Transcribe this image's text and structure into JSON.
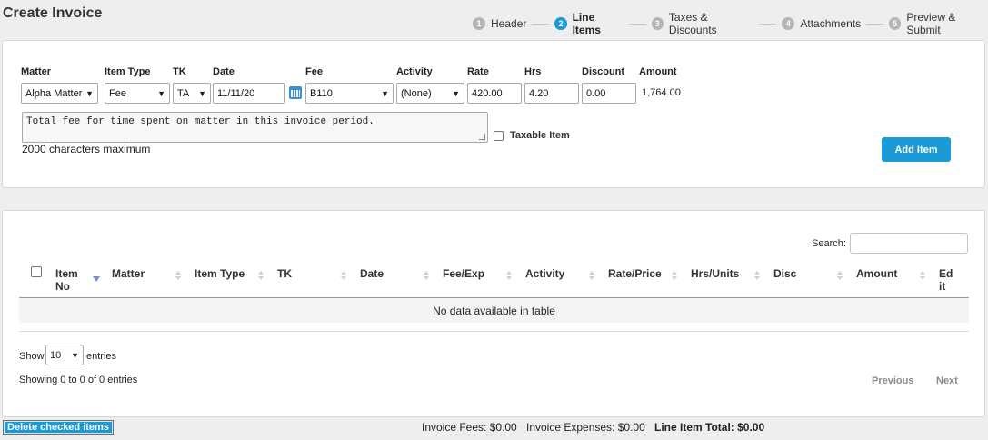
{
  "page": {
    "title": "Create Invoice"
  },
  "wizard": {
    "steps": [
      {
        "number": "1",
        "label": "Header",
        "active": false
      },
      {
        "number": "2",
        "label": "Line Items",
        "active": true
      },
      {
        "number": "3",
        "label": "Taxes & Discounts",
        "active": false
      },
      {
        "number": "4",
        "label": "Attachments",
        "active": false
      },
      {
        "number": "5",
        "label": "Preview & Submit",
        "active": false
      }
    ]
  },
  "form": {
    "labels": {
      "matter": "Matter",
      "item_type": "Item Type",
      "tk": "TK",
      "date": "Date",
      "fee": "Fee",
      "activity": "Activity",
      "rate": "Rate",
      "hrs": "Hrs",
      "discount": "Discount",
      "amount": "Amount"
    },
    "values": {
      "matter": "Alpha Matter",
      "item_type": "Fee",
      "tk": "TA",
      "date": "11/11/20",
      "fee": "B110",
      "activity": "(None)",
      "rate": "420.00",
      "hrs": "4.20",
      "discount": "0.00",
      "amount": "1,764.00"
    },
    "description": "Total fee for time spent on matter in this invoice period.",
    "char_limit_note": "2000 characters maximum",
    "taxable_label": "Taxable Item",
    "taxable_checked": false,
    "add_button": "Add Item"
  },
  "table": {
    "search_label": "Search:",
    "search_value": "",
    "columns": [
      {
        "line1": "Item",
        "line2": "No"
      },
      {
        "line1": "Matter",
        "line2": ""
      },
      {
        "line1": "Item Type",
        "line2": ""
      },
      {
        "line1": "TK",
        "line2": ""
      },
      {
        "line1": "Date",
        "line2": ""
      },
      {
        "line1": "Fee/Exp",
        "line2": ""
      },
      {
        "line1": "Activity",
        "line2": ""
      },
      {
        "line1": "Rate/Price",
        "line2": ""
      },
      {
        "line1": "Hrs/Units",
        "line2": ""
      },
      {
        "line1": "Disc",
        "line2": ""
      },
      {
        "line1": "Amount",
        "line2": ""
      },
      {
        "line1": "Ed",
        "line2": "it"
      }
    ],
    "empty_message": "No data available in table",
    "length": {
      "show": "Show",
      "value": "10",
      "entries": "entries"
    },
    "info": "Showing 0 to 0 of 0 entries",
    "pagination": {
      "previous": "Previous",
      "next": "Next"
    }
  },
  "footer": {
    "delete_button": "Delete checked items",
    "invoice_fees": "Invoice Fees: $0.00",
    "invoice_expenses": "Invoice Expenses: $0.00",
    "line_item_total": "Line Item Total: $0.00"
  },
  "colors": {
    "accent": "#1a9bd7",
    "inactive_step": "#b5b5b5",
    "page_background": "#eeeeee"
  }
}
